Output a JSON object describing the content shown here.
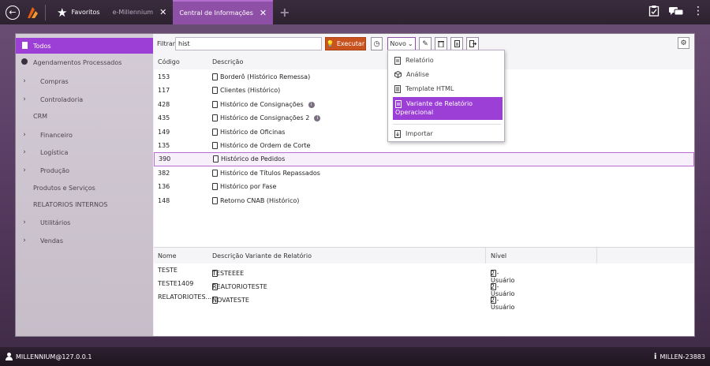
{
  "topbar": {
    "favorites_label": "Favoritos",
    "tabs": [
      {
        "label": "e-Millennium"
      },
      {
        "label": "Central de Informações"
      }
    ]
  },
  "sidebar": {
    "items": [
      {
        "label": "Todos"
      },
      {
        "label": "Agendamentos Processados"
      },
      {
        "label": "Compras"
      },
      {
        "label": "Controladoria"
      },
      {
        "label": "CRM"
      },
      {
        "label": "Financeiro"
      },
      {
        "label": "Logística"
      },
      {
        "label": "Produção"
      },
      {
        "label": "Produtos e Serviços"
      },
      {
        "label": "RELATORIOS INTERNOS"
      },
      {
        "label": "Utilitários"
      },
      {
        "label": "Vendas"
      }
    ]
  },
  "toolbar": {
    "filter_label": "Filtrar:",
    "filter_value": "hist",
    "execute_label": "Executar",
    "novo_label": "Novo"
  },
  "grid": {
    "columns": [
      "Código",
      "Descrição"
    ],
    "rows": [
      {
        "code": "153",
        "desc": "Borderô (Histórico Remessa)"
      },
      {
        "code": "117",
        "desc": "Clientes (Histórico)"
      },
      {
        "code": "428",
        "desc": "Histórico de Consignações"
      },
      {
        "code": "435",
        "desc": "Histórico de Consignações 2"
      },
      {
        "code": "149",
        "desc": "Histórico de Oficinas"
      },
      {
        "code": "135",
        "desc": "Histórico de Ordem de Corte"
      },
      {
        "code": "390",
        "desc": "Histórico de Pedidos"
      },
      {
        "code": "382",
        "desc": "Histórico de Títulos Repassados"
      },
      {
        "code": "136",
        "desc": "Histórico por Fase"
      },
      {
        "code": "148",
        "desc": "Retorno CNAB (Histórico)"
      }
    ]
  },
  "grid2": {
    "columns": [
      "Nome",
      "Descrição Variante de Relatório",
      "Nível"
    ],
    "rows": [
      {
        "nome": "TESTE",
        "desc": "TESTEEEE",
        "nivel": "2 - Usuário"
      },
      {
        "nome": "TESTE1409",
        "desc": "REALTORIOTESTE",
        "nivel": "2 - Usuário"
      },
      {
        "nome": "RELATORIOTES...",
        "desc": "NOVATESTE",
        "nivel": "2 - Usuário"
      }
    ]
  },
  "dropdown": {
    "items": [
      {
        "label": "Relatório"
      },
      {
        "label": "Análise"
      },
      {
        "label": "Template HTML"
      },
      {
        "label_line1": "Variante de Relatório",
        "label_line2": "Operacional"
      },
      {
        "label": "Importar"
      }
    ]
  },
  "status": {
    "user": "MILLENNIUM@127.0.0.1",
    "server": "MILLEN-23883"
  },
  "colors": {
    "accent": "#9b3fd6",
    "execute": "#c8531e",
    "tab_active": "#8e4fa6"
  }
}
